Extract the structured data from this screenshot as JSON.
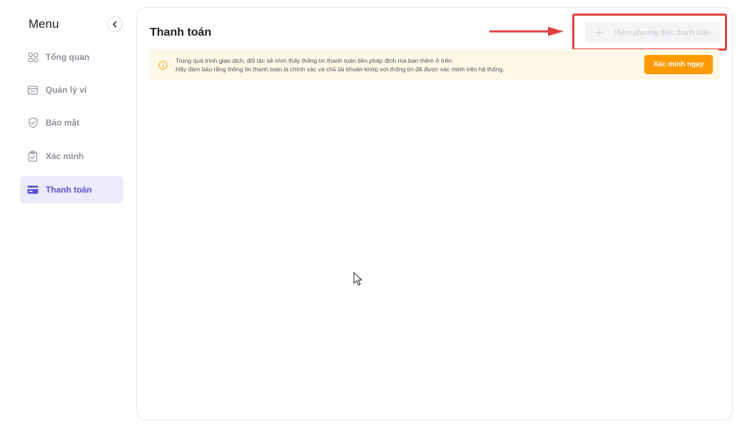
{
  "sidebar": {
    "title": "Menu",
    "items": [
      {
        "label": "Tổng quan",
        "icon": "grid-icon"
      },
      {
        "label": "Quản lý ví",
        "icon": "wallet-icon"
      },
      {
        "label": "Bảo mật",
        "icon": "shield-icon"
      },
      {
        "label": "Xác minh",
        "icon": "clipboard-check-icon"
      },
      {
        "label": "Thanh toán",
        "icon": "card-icon",
        "active": true
      }
    ]
  },
  "main": {
    "title": "Thanh toán",
    "add_button": {
      "label": "Thêm phương thức thanh toán",
      "disabled": true
    },
    "notice": {
      "line1": "Trong quá trình giao dịch, đối tác sẽ nhìn thấy thông tin thanh toán tiền pháp định mà bạn thêm ở trên.",
      "line2": "Hãy đảm bảo rằng thông tin thanh toán là chính xác và chủ tài khoản khớp với thông tin đã được xác minh trên hệ thống.",
      "button": "Xác minh ngay"
    }
  },
  "colors": {
    "accent": "#5b4fd6",
    "active_bg": "#ecebfb",
    "notice_bg": "#fff8e6",
    "verify_button": "#ff9a00",
    "annotation": "#e2403f"
  }
}
